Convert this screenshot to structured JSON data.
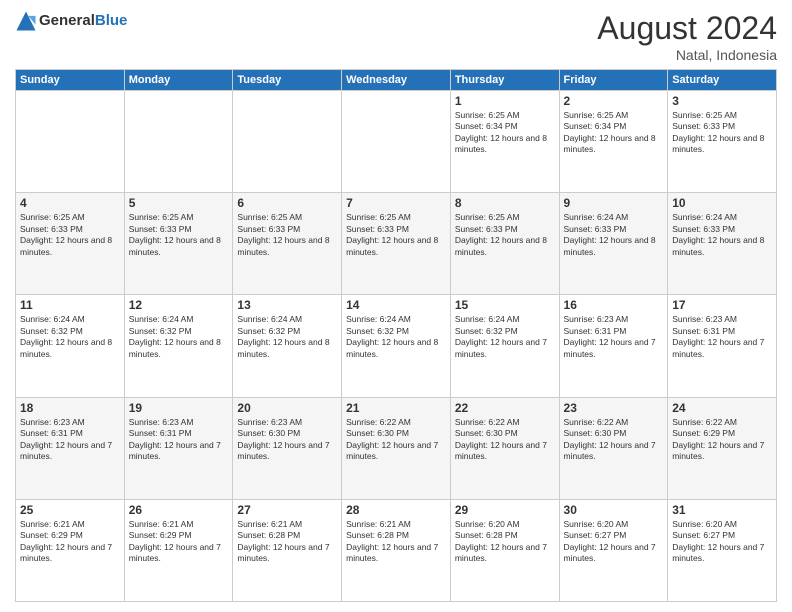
{
  "logo": {
    "general": "General",
    "blue": "Blue"
  },
  "header": {
    "month_year": "August 2024",
    "location": "Natal, Indonesia"
  },
  "weekdays": [
    "Sunday",
    "Monday",
    "Tuesday",
    "Wednesday",
    "Thursday",
    "Friday",
    "Saturday"
  ],
  "weeks": [
    [
      {
        "day": "",
        "sunrise": "",
        "sunset": "",
        "daylight": ""
      },
      {
        "day": "",
        "sunrise": "",
        "sunset": "",
        "daylight": ""
      },
      {
        "day": "",
        "sunrise": "",
        "sunset": "",
        "daylight": ""
      },
      {
        "day": "",
        "sunrise": "",
        "sunset": "",
        "daylight": ""
      },
      {
        "day": "1",
        "sunrise": "Sunrise: 6:25 AM",
        "sunset": "Sunset: 6:34 PM",
        "daylight": "Daylight: 12 hours and 8 minutes."
      },
      {
        "day": "2",
        "sunrise": "Sunrise: 6:25 AM",
        "sunset": "Sunset: 6:34 PM",
        "daylight": "Daylight: 12 hours and 8 minutes."
      },
      {
        "day": "3",
        "sunrise": "Sunrise: 6:25 AM",
        "sunset": "Sunset: 6:33 PM",
        "daylight": "Daylight: 12 hours and 8 minutes."
      }
    ],
    [
      {
        "day": "4",
        "sunrise": "Sunrise: 6:25 AM",
        "sunset": "Sunset: 6:33 PM",
        "daylight": "Daylight: 12 hours and 8 minutes."
      },
      {
        "day": "5",
        "sunrise": "Sunrise: 6:25 AM",
        "sunset": "Sunset: 6:33 PM",
        "daylight": "Daylight: 12 hours and 8 minutes."
      },
      {
        "day": "6",
        "sunrise": "Sunrise: 6:25 AM",
        "sunset": "Sunset: 6:33 PM",
        "daylight": "Daylight: 12 hours and 8 minutes."
      },
      {
        "day": "7",
        "sunrise": "Sunrise: 6:25 AM",
        "sunset": "Sunset: 6:33 PM",
        "daylight": "Daylight: 12 hours and 8 minutes."
      },
      {
        "day": "8",
        "sunrise": "Sunrise: 6:25 AM",
        "sunset": "Sunset: 6:33 PM",
        "daylight": "Daylight: 12 hours and 8 minutes."
      },
      {
        "day": "9",
        "sunrise": "Sunrise: 6:24 AM",
        "sunset": "Sunset: 6:33 PM",
        "daylight": "Daylight: 12 hours and 8 minutes."
      },
      {
        "day": "10",
        "sunrise": "Sunrise: 6:24 AM",
        "sunset": "Sunset: 6:33 PM",
        "daylight": "Daylight: 12 hours and 8 minutes."
      }
    ],
    [
      {
        "day": "11",
        "sunrise": "Sunrise: 6:24 AM",
        "sunset": "Sunset: 6:32 PM",
        "daylight": "Daylight: 12 hours and 8 minutes."
      },
      {
        "day": "12",
        "sunrise": "Sunrise: 6:24 AM",
        "sunset": "Sunset: 6:32 PM",
        "daylight": "Daylight: 12 hours and 8 minutes."
      },
      {
        "day": "13",
        "sunrise": "Sunrise: 6:24 AM",
        "sunset": "Sunset: 6:32 PM",
        "daylight": "Daylight: 12 hours and 8 minutes."
      },
      {
        "day": "14",
        "sunrise": "Sunrise: 6:24 AM",
        "sunset": "Sunset: 6:32 PM",
        "daylight": "Daylight: 12 hours and 8 minutes."
      },
      {
        "day": "15",
        "sunrise": "Sunrise: 6:24 AM",
        "sunset": "Sunset: 6:32 PM",
        "daylight": "Daylight: 12 hours and 7 minutes."
      },
      {
        "day": "16",
        "sunrise": "Sunrise: 6:23 AM",
        "sunset": "Sunset: 6:31 PM",
        "daylight": "Daylight: 12 hours and 7 minutes."
      },
      {
        "day": "17",
        "sunrise": "Sunrise: 6:23 AM",
        "sunset": "Sunset: 6:31 PM",
        "daylight": "Daylight: 12 hours and 7 minutes."
      }
    ],
    [
      {
        "day": "18",
        "sunrise": "Sunrise: 6:23 AM",
        "sunset": "Sunset: 6:31 PM",
        "daylight": "Daylight: 12 hours and 7 minutes."
      },
      {
        "day": "19",
        "sunrise": "Sunrise: 6:23 AM",
        "sunset": "Sunset: 6:31 PM",
        "daylight": "Daylight: 12 hours and 7 minutes."
      },
      {
        "day": "20",
        "sunrise": "Sunrise: 6:23 AM",
        "sunset": "Sunset: 6:30 PM",
        "daylight": "Daylight: 12 hours and 7 minutes."
      },
      {
        "day": "21",
        "sunrise": "Sunrise: 6:22 AM",
        "sunset": "Sunset: 6:30 PM",
        "daylight": "Daylight: 12 hours and 7 minutes."
      },
      {
        "day": "22",
        "sunrise": "Sunrise: 6:22 AM",
        "sunset": "Sunset: 6:30 PM",
        "daylight": "Daylight: 12 hours and 7 minutes."
      },
      {
        "day": "23",
        "sunrise": "Sunrise: 6:22 AM",
        "sunset": "Sunset: 6:30 PM",
        "daylight": "Daylight: 12 hours and 7 minutes."
      },
      {
        "day": "24",
        "sunrise": "Sunrise: 6:22 AM",
        "sunset": "Sunset: 6:29 PM",
        "daylight": "Daylight: 12 hours and 7 minutes."
      }
    ],
    [
      {
        "day": "25",
        "sunrise": "Sunrise: 6:21 AM",
        "sunset": "Sunset: 6:29 PM",
        "daylight": "Daylight: 12 hours and 7 minutes."
      },
      {
        "day": "26",
        "sunrise": "Sunrise: 6:21 AM",
        "sunset": "Sunset: 6:29 PM",
        "daylight": "Daylight: 12 hours and 7 minutes."
      },
      {
        "day": "27",
        "sunrise": "Sunrise: 6:21 AM",
        "sunset": "Sunset: 6:28 PM",
        "daylight": "Daylight: 12 hours and 7 minutes."
      },
      {
        "day": "28",
        "sunrise": "Sunrise: 6:21 AM",
        "sunset": "Sunset: 6:28 PM",
        "daylight": "Daylight: 12 hours and 7 minutes."
      },
      {
        "day": "29",
        "sunrise": "Sunrise: 6:20 AM",
        "sunset": "Sunset: 6:28 PM",
        "daylight": "Daylight: 12 hours and 7 minutes."
      },
      {
        "day": "30",
        "sunrise": "Sunrise: 6:20 AM",
        "sunset": "Sunset: 6:27 PM",
        "daylight": "Daylight: 12 hours and 7 minutes."
      },
      {
        "day": "31",
        "sunrise": "Sunrise: 6:20 AM",
        "sunset": "Sunset: 6:27 PM",
        "daylight": "Daylight: 12 hours and 7 minutes."
      }
    ]
  ]
}
